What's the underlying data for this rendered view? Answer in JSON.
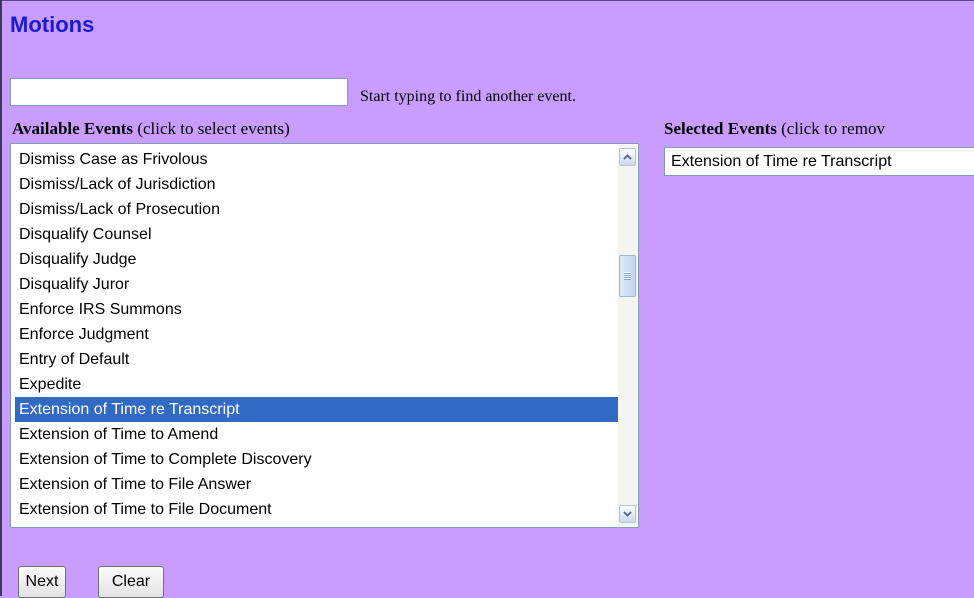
{
  "page": {
    "title": "Motions",
    "background": "#c99dff",
    "title_color": "#1a1ad8"
  },
  "search": {
    "value": "",
    "placeholder": "",
    "hint": "Start typing to find another event."
  },
  "available": {
    "label_bold": "Available Events",
    "label_rest": " (click to select events)",
    "items": [
      "Dismiss Case as Frivolous",
      "Dismiss/Lack of Jurisdiction",
      "Dismiss/Lack of Prosecution",
      "Disqualify Counsel",
      "Disqualify Judge",
      "Disqualify Juror",
      "Enforce IRS Summons",
      "Enforce Judgment",
      "Entry of Default",
      "Expedite",
      "Extension of Time re Transcript",
      "Extension of Time to Amend",
      "Extension of Time to Complete Discovery",
      "Extension of Time to File Answer",
      "Extension of Time to File Document"
    ],
    "selected_item": "Extension of Time re Transcript",
    "highlight_color": "#316ac5"
  },
  "selected": {
    "label_bold": "Selected Events",
    "label_rest": " (click to remov",
    "items": [
      "Extension of Time re Transcript"
    ]
  },
  "buttons": {
    "next": "Next",
    "clear": "Clear"
  }
}
